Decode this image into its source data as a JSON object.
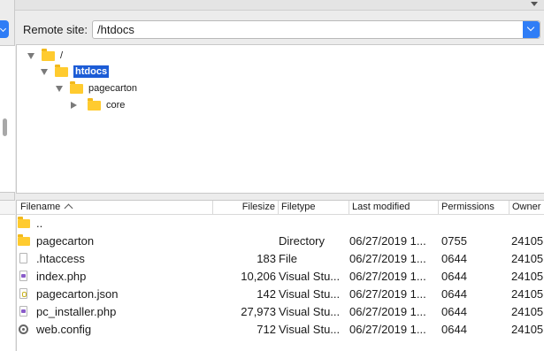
{
  "remote": {
    "label": "Remote site:",
    "path": "/htdocs"
  },
  "tree": [
    {
      "label": "/",
      "expanded": true,
      "selected": false
    },
    {
      "label": "htdocs",
      "expanded": true,
      "selected": true
    },
    {
      "label": "pagecarton",
      "expanded": true,
      "selected": false
    },
    {
      "label": "core",
      "expanded": false,
      "selected": false
    }
  ],
  "columns": {
    "filename": "Filename",
    "filesize": "Filesize",
    "filetype": "Filetype",
    "modified": "Last modified",
    "permissions": "Permissions",
    "owner": "Owner"
  },
  "files": [
    {
      "name": "..",
      "size": "",
      "type": "",
      "modified": "",
      "perms": "",
      "owner": "",
      "icon": "folder-icon"
    },
    {
      "name": "pagecarton",
      "size": "",
      "type": "Directory",
      "modified": "06/27/2019 1...",
      "perms": "0755",
      "owner": "24105",
      "icon": "folder-icon"
    },
    {
      "name": ".htaccess",
      "size": "183",
      "type": "File",
      "modified": "06/27/2019 1...",
      "perms": "0644",
      "owner": "24105",
      "icon": "document-icon"
    },
    {
      "name": "index.php",
      "size": "10,206",
      "type": "Visual Stu...",
      "modified": "06/27/2019 1...",
      "perms": "0644",
      "owner": "24105",
      "icon": "php-file-icon"
    },
    {
      "name": "pagecarton.json",
      "size": "142",
      "type": "Visual Stu...",
      "modified": "06/27/2019 1...",
      "perms": "0644",
      "owner": "24105",
      "icon": "json-file-icon"
    },
    {
      "name": "pc_installer.php",
      "size": "27,973",
      "type": "Visual Stu...",
      "modified": "06/27/2019 1...",
      "perms": "0644",
      "owner": "24105",
      "icon": "php-file-icon"
    },
    {
      "name": "web.config",
      "size": "712",
      "type": "Visual Stu...",
      "modified": "06/27/2019 1...",
      "perms": "0644",
      "owner": "24105",
      "icon": "gear-icon"
    }
  ],
  "colors": {
    "selection": "#1c5cd6",
    "accent": "#2f7df6",
    "folder": "#ffcb2f"
  }
}
